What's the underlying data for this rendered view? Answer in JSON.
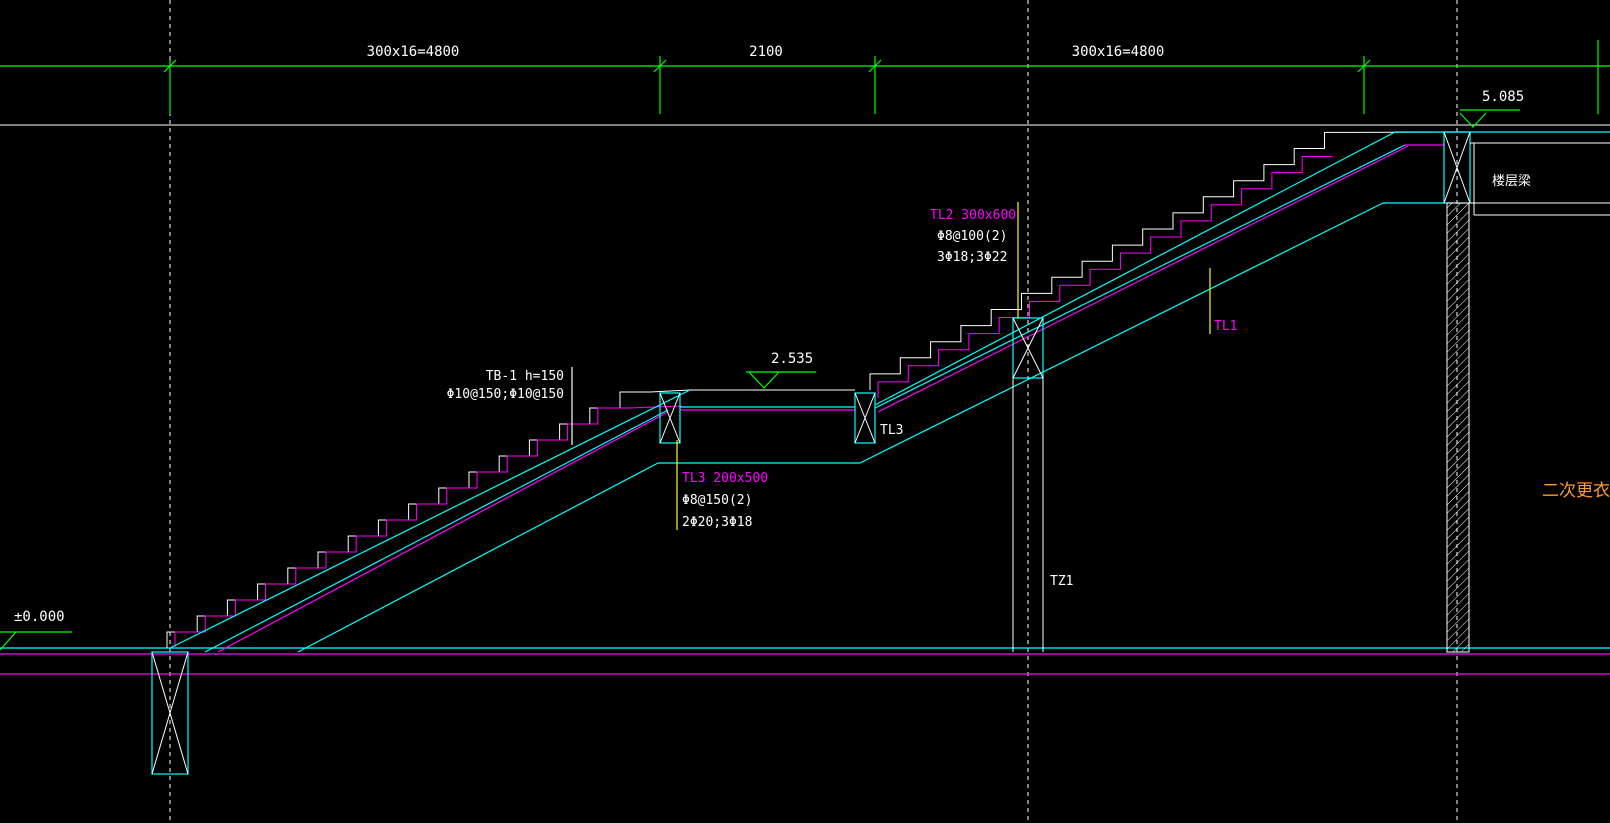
{
  "colors": {
    "background": "#000000",
    "dimension": "#00ff00",
    "outline": "#00ffff",
    "rebar": "#ff00ff",
    "white": "#ffffff",
    "leader": "#ffff00",
    "room": "#ff9933"
  },
  "dimensions": {
    "flight_1": "300x16=4800",
    "landing": "2100",
    "flight_2": "300x16=4800"
  },
  "elevations": {
    "ground": "±0.000",
    "landing": "2.535",
    "top": "5.085"
  },
  "labels": {
    "tb1_title": "TB-1 h=150",
    "tb1_rebar": "Φ10@150;Φ10@150",
    "tl2_title": "TL2 300x600",
    "tl2_stirrup": "Φ8@100(2)",
    "tl2_main": "3Φ18;3Φ22",
    "tl3_title": "TL3 200x500",
    "tl3_stirrup": "Φ8@150(2)",
    "tl3_main": "2Φ20;3Φ18",
    "tl3_tag": "TL3",
    "tl1_tag": "TL1",
    "tz1_tag": "TZ1",
    "floor_beam": "楼层梁",
    "room_name": "二次更衣"
  }
}
